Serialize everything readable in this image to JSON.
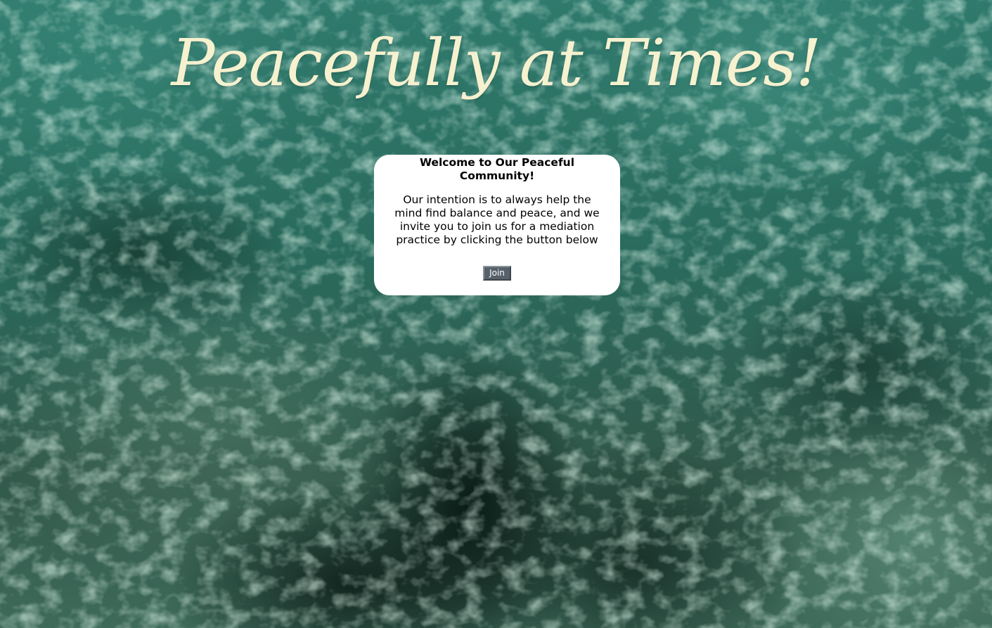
{
  "page": {
    "title": "Peacefully at Times!"
  },
  "welcome": {
    "heading": "Welcome to Our Peaceful Community!",
    "body": "Our intention is to always help the mind find balance and peace, and we invite you to join us for a mediation practice by clicking the button below",
    "join_label": "Join"
  },
  "colors": {
    "title": "#f6f1cf",
    "water": "#2c6a5f",
    "card": "#ffffff",
    "button": "#56616b"
  }
}
